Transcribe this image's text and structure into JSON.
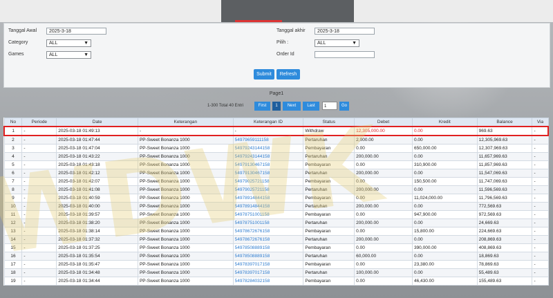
{
  "filters": {
    "tanggal_awal_label": "Tanggal Awal",
    "tanggal_awal_value": "2025-3-18",
    "tanggal_akhir_label": "Tanggal akhir",
    "tanggal_akhir_value": "2025-3-18",
    "category_label": "Category",
    "category_value": "ALL",
    "pilih_label": "Pilih :",
    "pilih_value": "ALL",
    "games_label": "Games",
    "games_value": "ALL",
    "order_id_label": "Order Id",
    "order_id_value": "",
    "submit_label": "Submit",
    "refresh_label": "Refresh"
  },
  "pager": {
    "title": "Page1",
    "info": "1-300 Total 40 Entri",
    "first": "First",
    "page": "1",
    "next": "Next",
    "last": "Last",
    "page_input": "1",
    "go": "Go"
  },
  "table": {
    "headers": [
      "No",
      "Periode",
      "Date",
      "Keterangan",
      "Keterangan ID",
      "Status",
      "Debet",
      "Kredit",
      "Balance",
      "Via"
    ],
    "rows": [
      [
        "1",
        "-",
        "2025-03-18 01:49:13",
        "-",
        "-",
        "Withdraw",
        "12,305,000.00",
        "0.00",
        "969.63",
        "-"
      ],
      [
        "2",
        "-",
        "2025-03-18 01:47:44",
        "PP-Sweet Bonanza 1000",
        "54979659111158",
        "Pertaruhan",
        "2,000.00",
        "0.00",
        "12,305,969.63",
        "-"
      ],
      [
        "3",
        "-",
        "2025-03-18 01:47:04",
        "PP-Sweet Bonanza 1000",
        "54979243144158",
        "Pembayaran",
        "0.00",
        "650,000.00",
        "12,307,969.63",
        "-"
      ],
      [
        "4",
        "-",
        "2025-03-18 01:43:22",
        "PP-Sweet Bonanza 1000",
        "54979243144158",
        "Pertaruhan",
        "200,000.00",
        "0.00",
        "11,657,969.63",
        "-"
      ],
      [
        "5",
        "-",
        "2025-03-18 01:43:18",
        "PP-Sweet Bonanza 1000",
        "54979130467158",
        "Pembayaran",
        "0.00",
        "310,900.00",
        "11,857,969.63",
        "-"
      ],
      [
        "6",
        "-",
        "2025-03-18 01:42:12",
        "PP-Sweet Bonanza 1000",
        "54979130467158",
        "Pertaruhan",
        "200,000.00",
        "0.00",
        "11,547,069.63",
        "-"
      ],
      [
        "7",
        "-",
        "2025-03-18 01:42:07",
        "PP-Sweet Bonanza 1000",
        "54979025721158",
        "Pembayaran",
        "0.00",
        "150,500.00",
        "11,747,069.63",
        "-"
      ],
      [
        "8",
        "-",
        "2025-03-18 01:41:08",
        "PP-Sweet Bonanza 1000",
        "54979025721158",
        "Pertaruhan",
        "200,000.00",
        "0.00",
        "11,596,569.63",
        "-"
      ],
      [
        "9",
        "-",
        "2025-03-18 01:40:59",
        "PP-Sweet Bonanza 1000",
        "54978914844158",
        "Pembayaran",
        "0.00",
        "11,024,000.00",
        "11,796,569.63",
        "-"
      ],
      [
        "10",
        "-",
        "2025-03-18 01:40:00",
        "PP-Sweet Bonanza 1000",
        "54978914844158",
        "Pertaruhan",
        "200,000.00",
        "0.00",
        "772,569.63",
        "-"
      ],
      [
        "11",
        "-",
        "2025-03-18 01:39:57",
        "PP-Sweet Bonanza 1000",
        "54978751001158",
        "Pembayaran",
        "0.00",
        "947,900.00",
        "972,569.63",
        "-"
      ],
      [
        "12",
        "-",
        "2025-03-18 01:38:20",
        "PP-Sweet Bonanza 1000",
        "54978751001158",
        "Pertaruhan",
        "200,000.00",
        "0.00",
        "24,669.63",
        "-"
      ],
      [
        "13",
        "-",
        "2025-03-18 01:38:14",
        "PP-Sweet Bonanza 1000",
        "54978672676158",
        "Pembayaran",
        "0.00",
        "15,800.00",
        "224,669.63",
        "-"
      ],
      [
        "14",
        "-",
        "2025-03-18 01:37:32",
        "PP-Sweet Bonanza 1000",
        "54978672676158",
        "Pertaruhan",
        "200,000.00",
        "0.00",
        "208,869.63",
        "-"
      ],
      [
        "15",
        "-",
        "2025-03-18 01:37:25",
        "PP-Sweet Bonanza 1000",
        "54978508889158",
        "Pembayaran",
        "0.00",
        "390,000.00",
        "408,869.63",
        "-"
      ],
      [
        "16",
        "-",
        "2025-03-18 01:35:54",
        "PP-Sweet Bonanza 1000",
        "54978508889158",
        "Pertaruhan",
        "60,000.00",
        "0.00",
        "18,869.63",
        "-"
      ],
      [
        "17",
        "-",
        "2025-03-18 01:35:47",
        "PP-Sweet Bonanza 1000",
        "54978397017158",
        "Pembayaran",
        "0.00",
        "23,380.00",
        "78,869.63",
        "-"
      ],
      [
        "18",
        "-",
        "2025-03-18 01:34:48",
        "PP-Sweet Bonanza 1000",
        "54978397017158",
        "Pertaruhan",
        "100,000.00",
        "0.00",
        "55,489.63",
        "-"
      ],
      [
        "19",
        "-",
        "2025-03-18 01:34:44",
        "PP-Sweet Bonanza 1000",
        "54978284032158",
        "Pembayaran",
        "0.00",
        "46,430.00",
        "155,489.63",
        "-"
      ]
    ]
  },
  "watermark": "WDWK"
}
